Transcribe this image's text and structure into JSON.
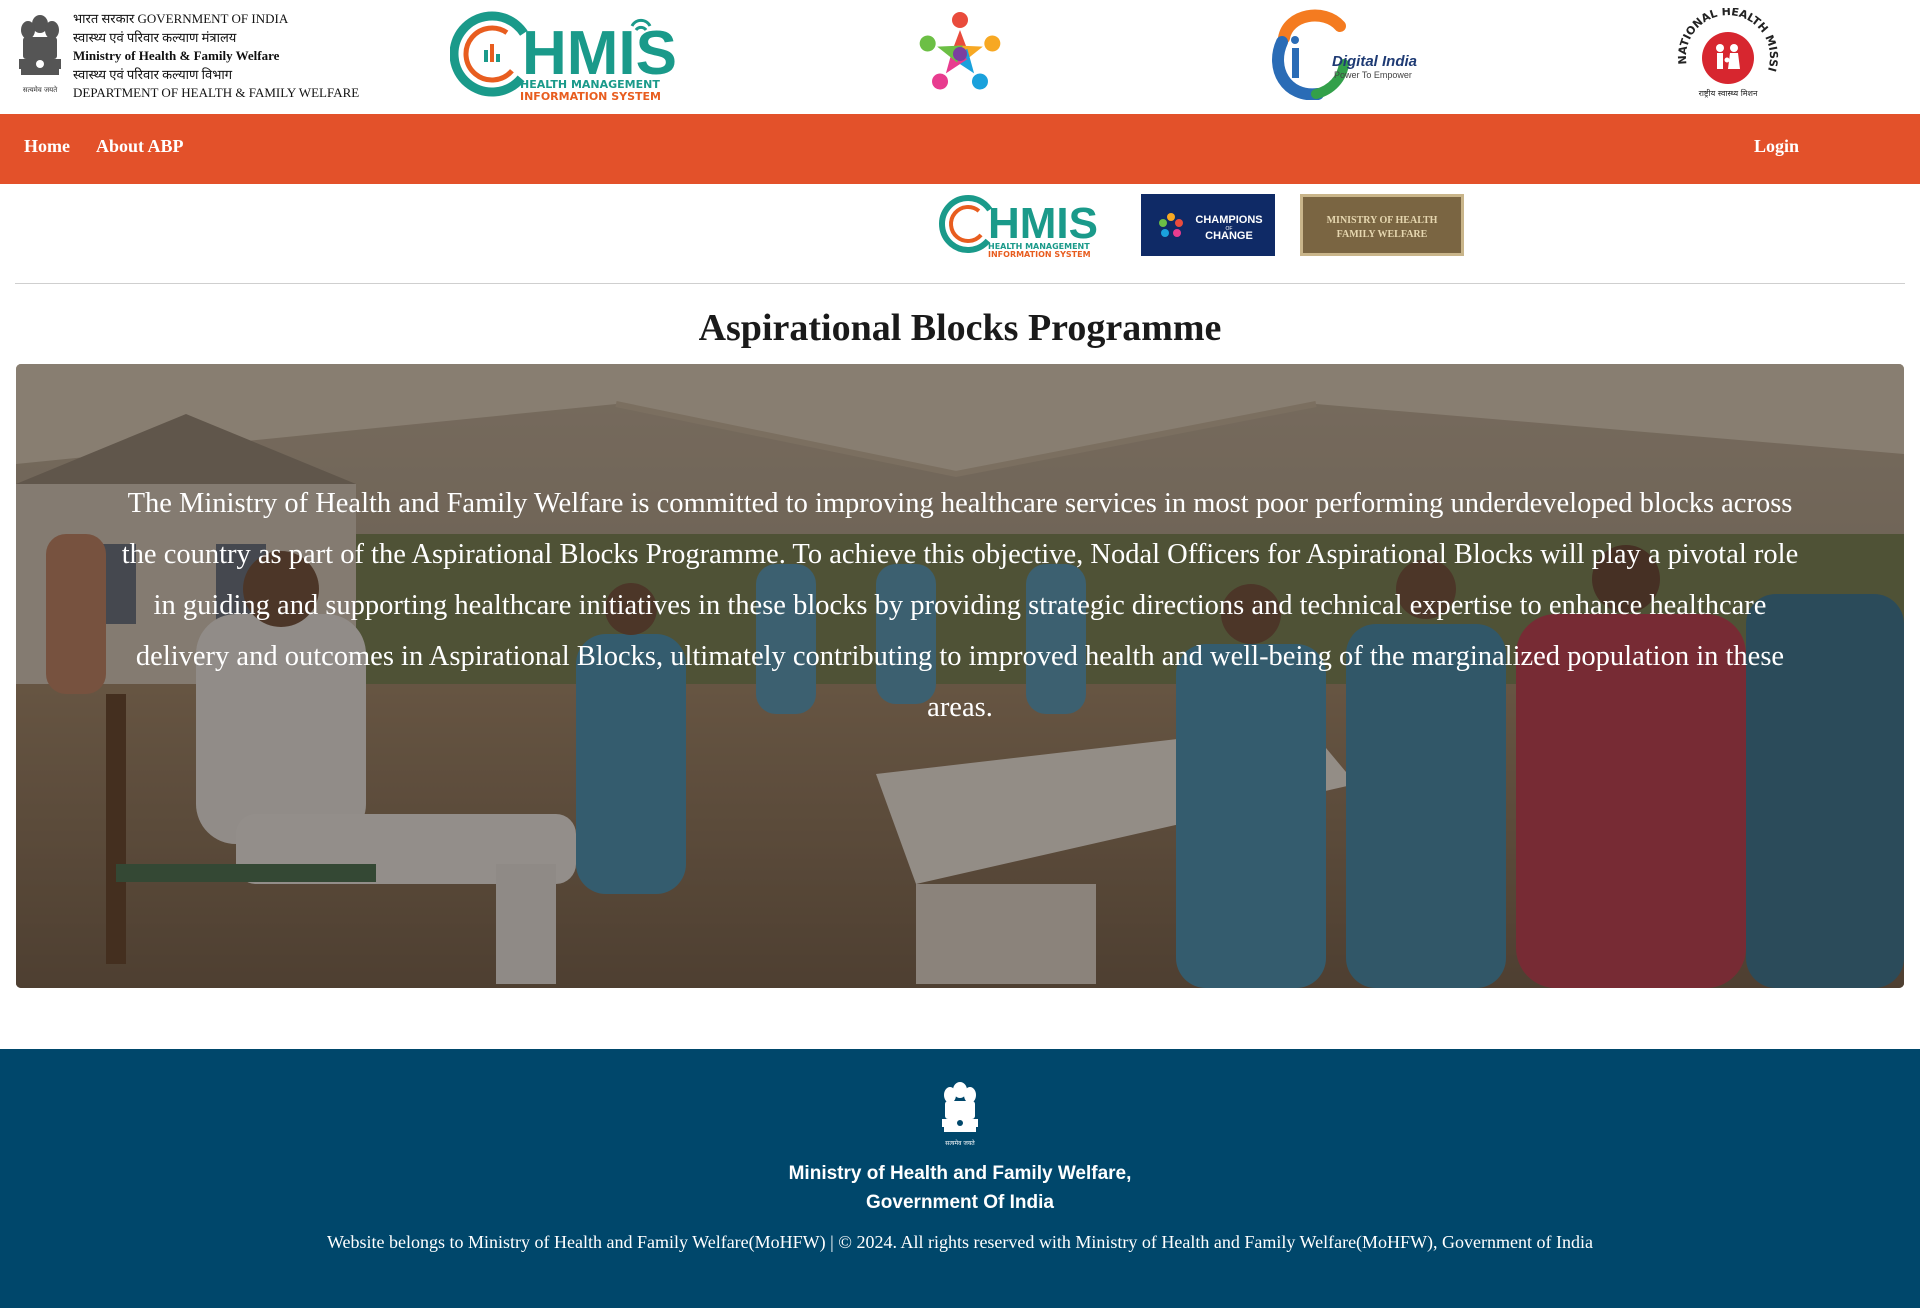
{
  "header": {
    "gov_lines": [
      "भारत सरकार GOVERNMENT OF INDIA",
      "स्वास्थ्य एवं परिवार कल्याण मंत्रालय",
      "Ministry of Health & Family Welfare",
      "स्वास्थ्य एवं परिवार कल्याण विभाग",
      "DEPARTMENT OF HEALTH & FAMILY WELFARE"
    ],
    "emblem_caption": "सत्यमेव जयते",
    "hmis_logo": {
      "wordmark": "HMIS",
      "line1": "HEALTH   MANAGEMENT",
      "line2": "INFORMATION SYSTEM"
    },
    "digital_india": {
      "title": "Digital India",
      "tagline": "Power To Empower"
    },
    "nhm_logo": {
      "ring_text": "NATIONAL HEALTH MISSION",
      "hindi": "राष्ट्रीय स्वास्थ्य मिशन"
    }
  },
  "nav": {
    "home": "Home",
    "about": "About ABP",
    "login": "Login"
  },
  "partners": {
    "hmis": {
      "wordmark": "HMIS",
      "line1": "HEALTH   MANAGEMENT",
      "line2": "INFORMATION SYSTEM"
    },
    "champions": {
      "line1": "CHAMPIONS",
      "line2": "OF",
      "line3": "CHANGE"
    },
    "mohfw": {
      "line1": "MINISTRY OF HEALTH",
      "line2": "FAMILY WELFARE"
    }
  },
  "page": {
    "title": "Aspirational Blocks Programme",
    "hero_text": "The Ministry of Health and Family Welfare is committed to improving healthcare services in most poor performing underdeveloped blocks across the country as part of the Aspirational Blocks Programme. To achieve this objective, Nodal Officers for Aspirational Blocks will play a pivotal role in guiding and supporting healthcare initiatives in these blocks by providing strategic directions and technical expertise to enhance healthcare delivery and outcomes in Aspirational Blocks, ultimately contributing to improved health and well-being of the marginalized population in these areas."
  },
  "footer": {
    "emblem_caption": "सत्यमेव जयते",
    "ministry_line1": "Ministry of Health and Family Welfare,",
    "ministry_line2": "Government Of India",
    "copyright": "Website belongs to Ministry of Health and Family Welfare(MoHFW) | © 2024. All rights reserved with Ministry of Health and Family Welfare(MoHFW), Government of India"
  },
  "colors": {
    "nav_bg": "#e3512a",
    "footer_bg": "#00476b",
    "hmis_teal": "#1a9a8a",
    "hmis_orange": "#e85d1f",
    "champions_bg": "#0f2a66",
    "nhm_red": "#d7262f"
  }
}
